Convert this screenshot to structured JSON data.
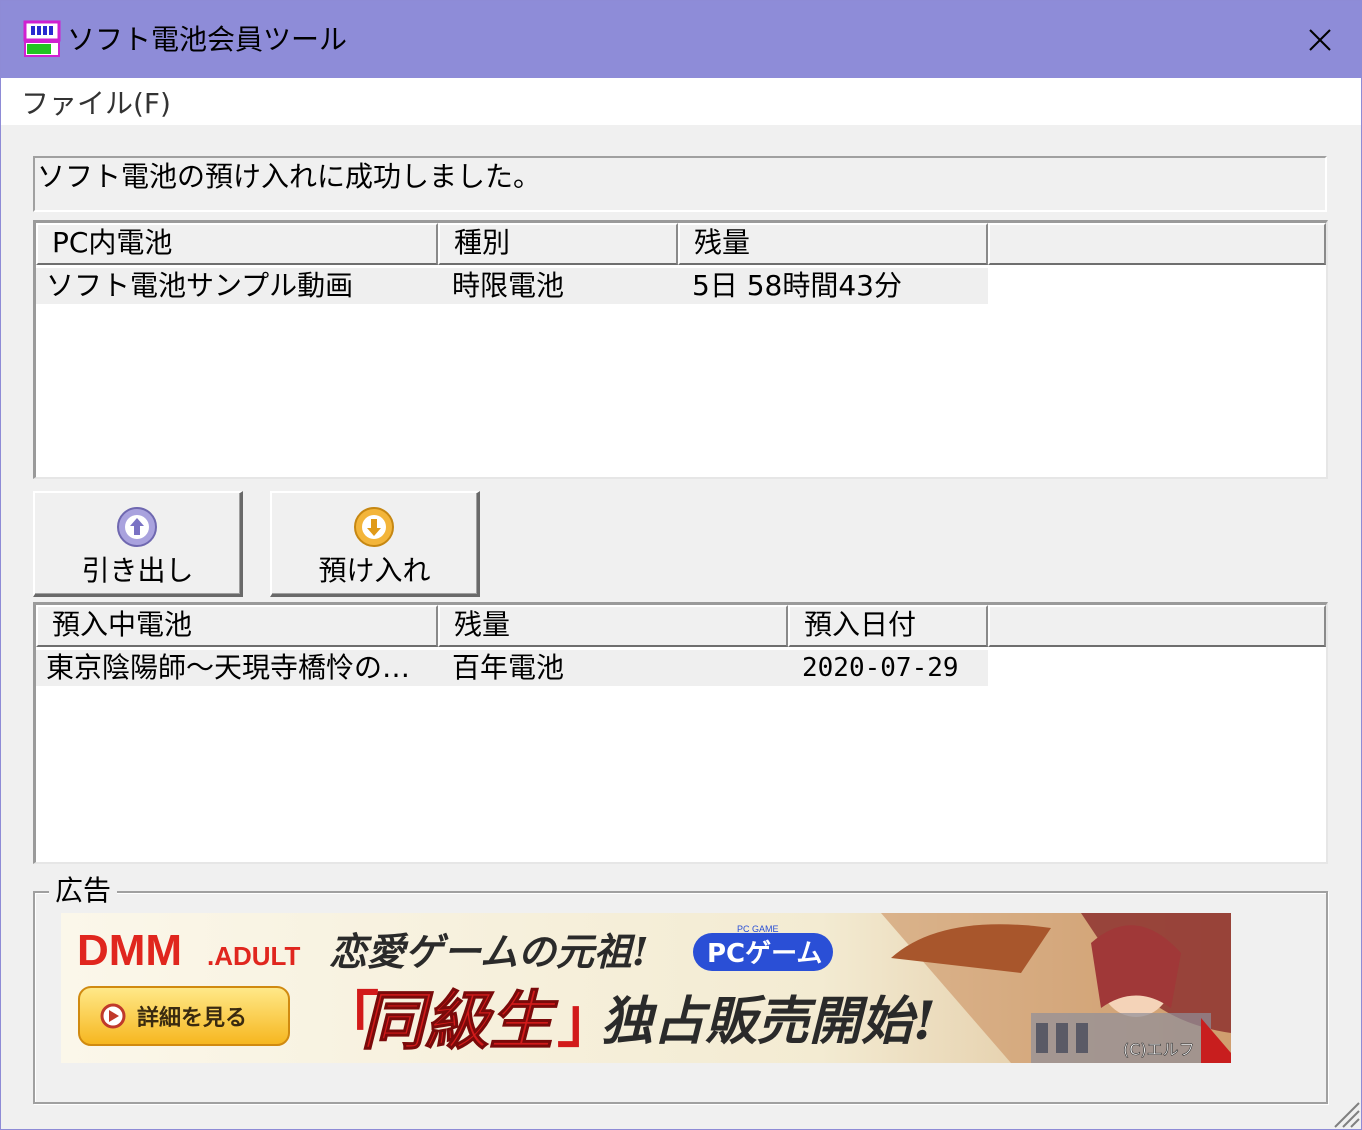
{
  "window": {
    "title": "ソフト電池会員ツール",
    "close_glyph": "✕",
    "titlebar_color": "#8e8cd8"
  },
  "menu": {
    "items": [
      {
        "label": "ファイル(F)"
      }
    ]
  },
  "status": {
    "message": "ソフト電池の預け入れに成功しました。"
  },
  "pc_list": {
    "columns": [
      "PC内電池",
      "種別",
      "残量"
    ],
    "rows": [
      {
        "name": "ソフト電池サンプル動画",
        "type": "時限電池",
        "remaining": "5日 58時間43分"
      }
    ]
  },
  "buttons": {
    "withdraw": {
      "label": "引き出し",
      "icon": "arrow-up-circle-icon",
      "color": "#a9a2de"
    },
    "deposit": {
      "label": "預け入れ",
      "icon": "arrow-down-circle-icon",
      "color": "#f3b53a"
    }
  },
  "deposited_list": {
    "columns": [
      "預入中電池",
      "残量",
      "預入日付"
    ],
    "rows": [
      {
        "name": "東京陰陽師～天現寺橋怜の…",
        "remaining": "百年電池",
        "date": "2020-07-29"
      }
    ]
  },
  "ad_group": {
    "label": "広告",
    "banner": {
      "brand": "DMM",
      "brand_suffix": ".ADULT",
      "detail_button": "詳細を見る",
      "headline": "恋愛ゲームの元祖!",
      "badge_small": "PC GAME",
      "badge": "PCゲーム",
      "title_quote_open": "「",
      "title": "同級生",
      "title_quote_close": "」",
      "tagline": "独占販売開始!",
      "copyright": "(C)エルフ"
    }
  }
}
